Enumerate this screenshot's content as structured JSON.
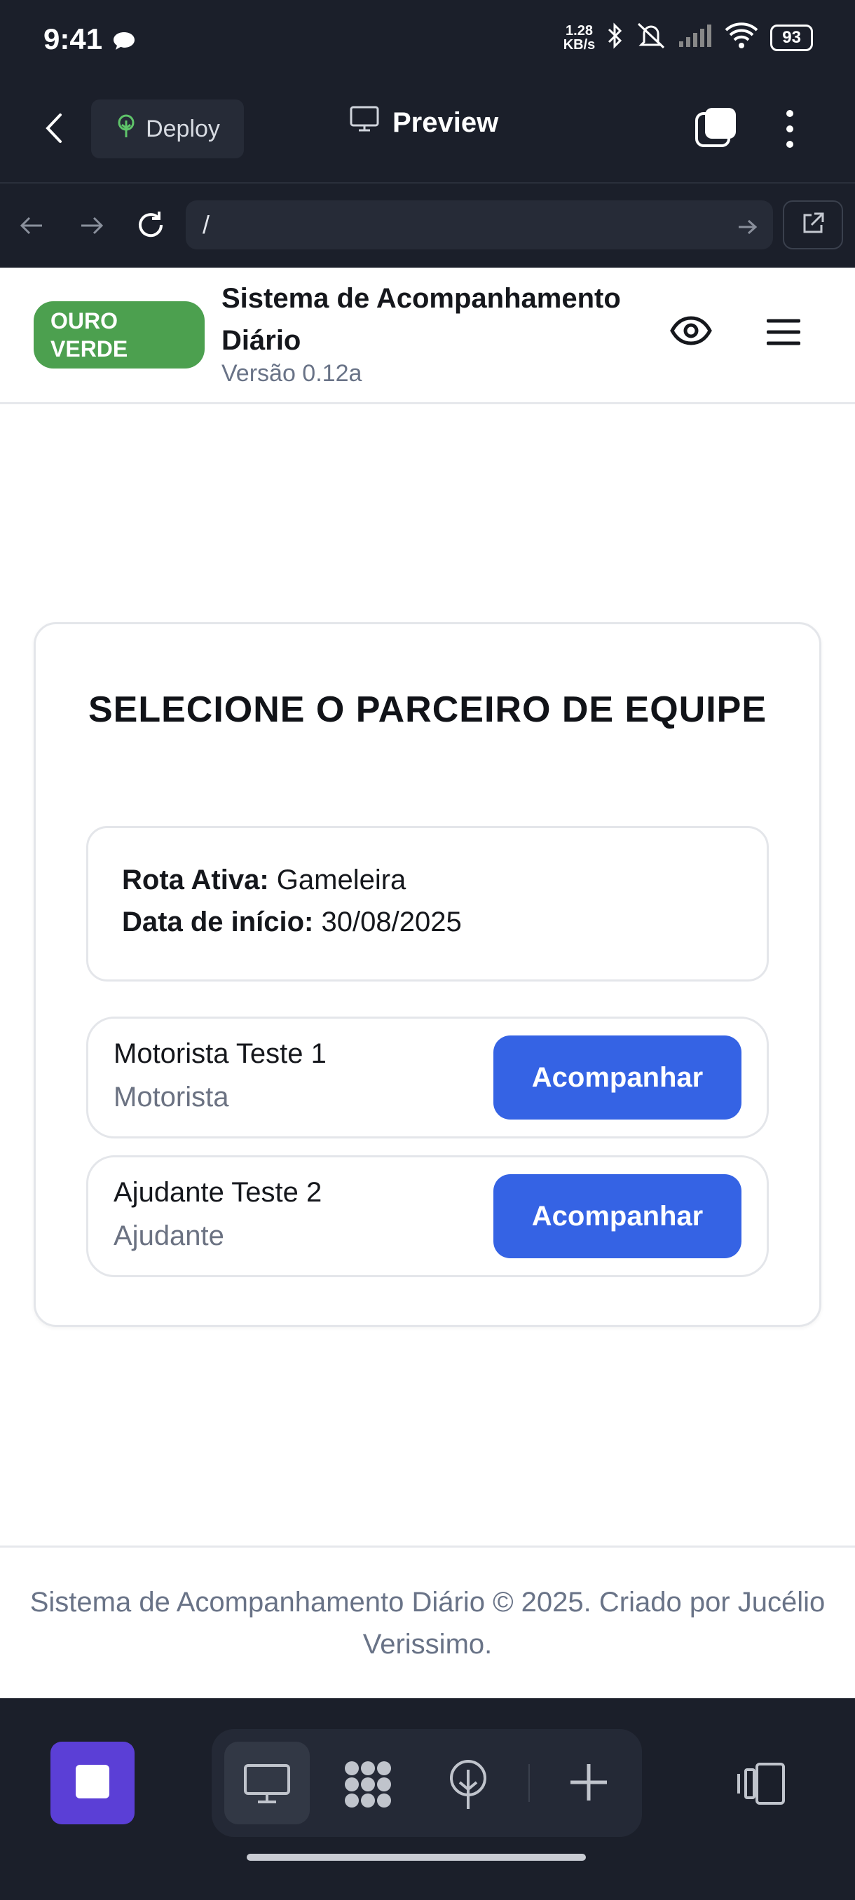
{
  "status_bar": {
    "time": "9:41",
    "net_speed_value": "1.28",
    "net_speed_unit": "KB/s",
    "battery": "93"
  },
  "app_bar": {
    "deploy_label": "Deploy",
    "preview_label": "Preview"
  },
  "browser": {
    "url": "/"
  },
  "site": {
    "logo_line1": "OURO",
    "logo_line2": "VERDE",
    "title": "Sistema de Acompanhamento Diário",
    "version": "Versão 0.12a"
  },
  "card": {
    "title": "SELECIONE O PARCEIRO DE EQUIPE",
    "route_label": "Rota Ativa:",
    "route_value": "Gameleira",
    "date_label": "Data de início:",
    "date_value": "30/08/2025",
    "partners": [
      {
        "name": "Motorista Teste 1",
        "role": "Motorista",
        "action": "Acompanhar"
      },
      {
        "name": "Ajudante Teste 2",
        "role": "Ajudante",
        "action": "Acompanhar"
      }
    ]
  },
  "footer": {
    "text": "Sistema de Acompanhamento Diário © 2025. Criado por Jucélio Verissimo."
  },
  "colors": {
    "logo_green": "#4ca04f",
    "button_blue": "#3563e4",
    "dark_chrome": "#1b1f2a",
    "stop_purple": "#5b3fd6"
  }
}
